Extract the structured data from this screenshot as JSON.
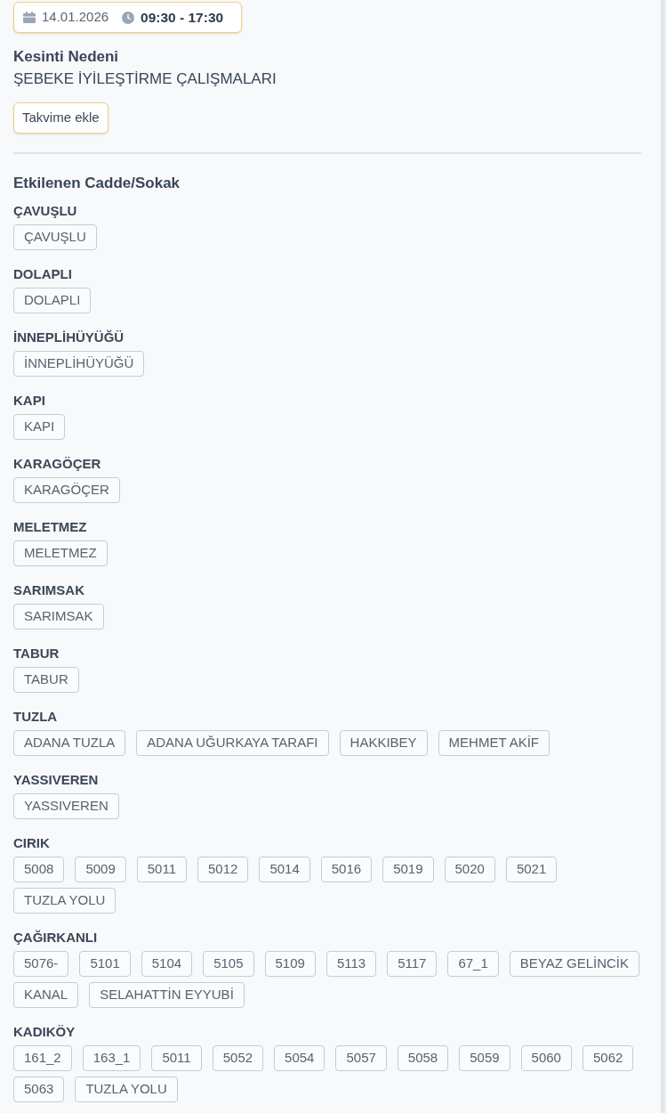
{
  "schedule": {
    "date": "14.01.2026",
    "time": "09:30 - 17:30"
  },
  "reason": {
    "label": "Kesinti Nedeni",
    "value": "ŞEBEKE İYİLEŞTİRME ÇALIŞMALARI"
  },
  "calendar_button": "Takvime ekle",
  "streets": {
    "title": "Etkilenen Cadde/Sokak",
    "groups": [
      {
        "name": "ÇAVUŞLU",
        "tags": [
          "ÇAVUŞLU"
        ]
      },
      {
        "name": "DOLAPLI",
        "tags": [
          "DOLAPLI"
        ]
      },
      {
        "name": "İNNEPLİHÜYÜĞÜ",
        "tags": [
          "İNNEPLİHÜYÜĞÜ"
        ]
      },
      {
        "name": "KAPI",
        "tags": [
          "KAPI"
        ]
      },
      {
        "name": "KARAGÖÇER",
        "tags": [
          "KARAGÖÇER"
        ]
      },
      {
        "name": "MELETMEZ",
        "tags": [
          "MELETMEZ"
        ]
      },
      {
        "name": "SARIMSAK",
        "tags": [
          "SARIMSAK"
        ]
      },
      {
        "name": "TABUR",
        "tags": [
          "TABUR"
        ]
      },
      {
        "name": "TUZLA",
        "tags": [
          "ADANA TUZLA",
          "ADANA UĞURKAYA TARAFI",
          "HAKKIBEY",
          "MEHMET AKİF"
        ]
      },
      {
        "name": "YASSIVEREN",
        "tags": [
          "YASSIVEREN"
        ]
      },
      {
        "name": "CIRIK",
        "tags": [
          "5008",
          "5009",
          "5011",
          "5012",
          "5014",
          "5016",
          "5019",
          "5020",
          "5021",
          "TUZLA YOLU"
        ]
      },
      {
        "name": "ÇAĞIRKANLI",
        "tags": [
          "5076-",
          "5101",
          "5104",
          "5105",
          "5109",
          "5113",
          "5117",
          "67_1",
          "BEYAZ GELİNCİK",
          "KANAL",
          "SELAHATTİN EYYUBİ"
        ]
      },
      {
        "name": "KADIKÖY",
        "tags": [
          "161_2",
          "163_1",
          "5011",
          "5052",
          "5054",
          "5057",
          "5058",
          "5059",
          "5060",
          "5062",
          "5063",
          "TUZLA YOLU"
        ]
      }
    ]
  }
}
